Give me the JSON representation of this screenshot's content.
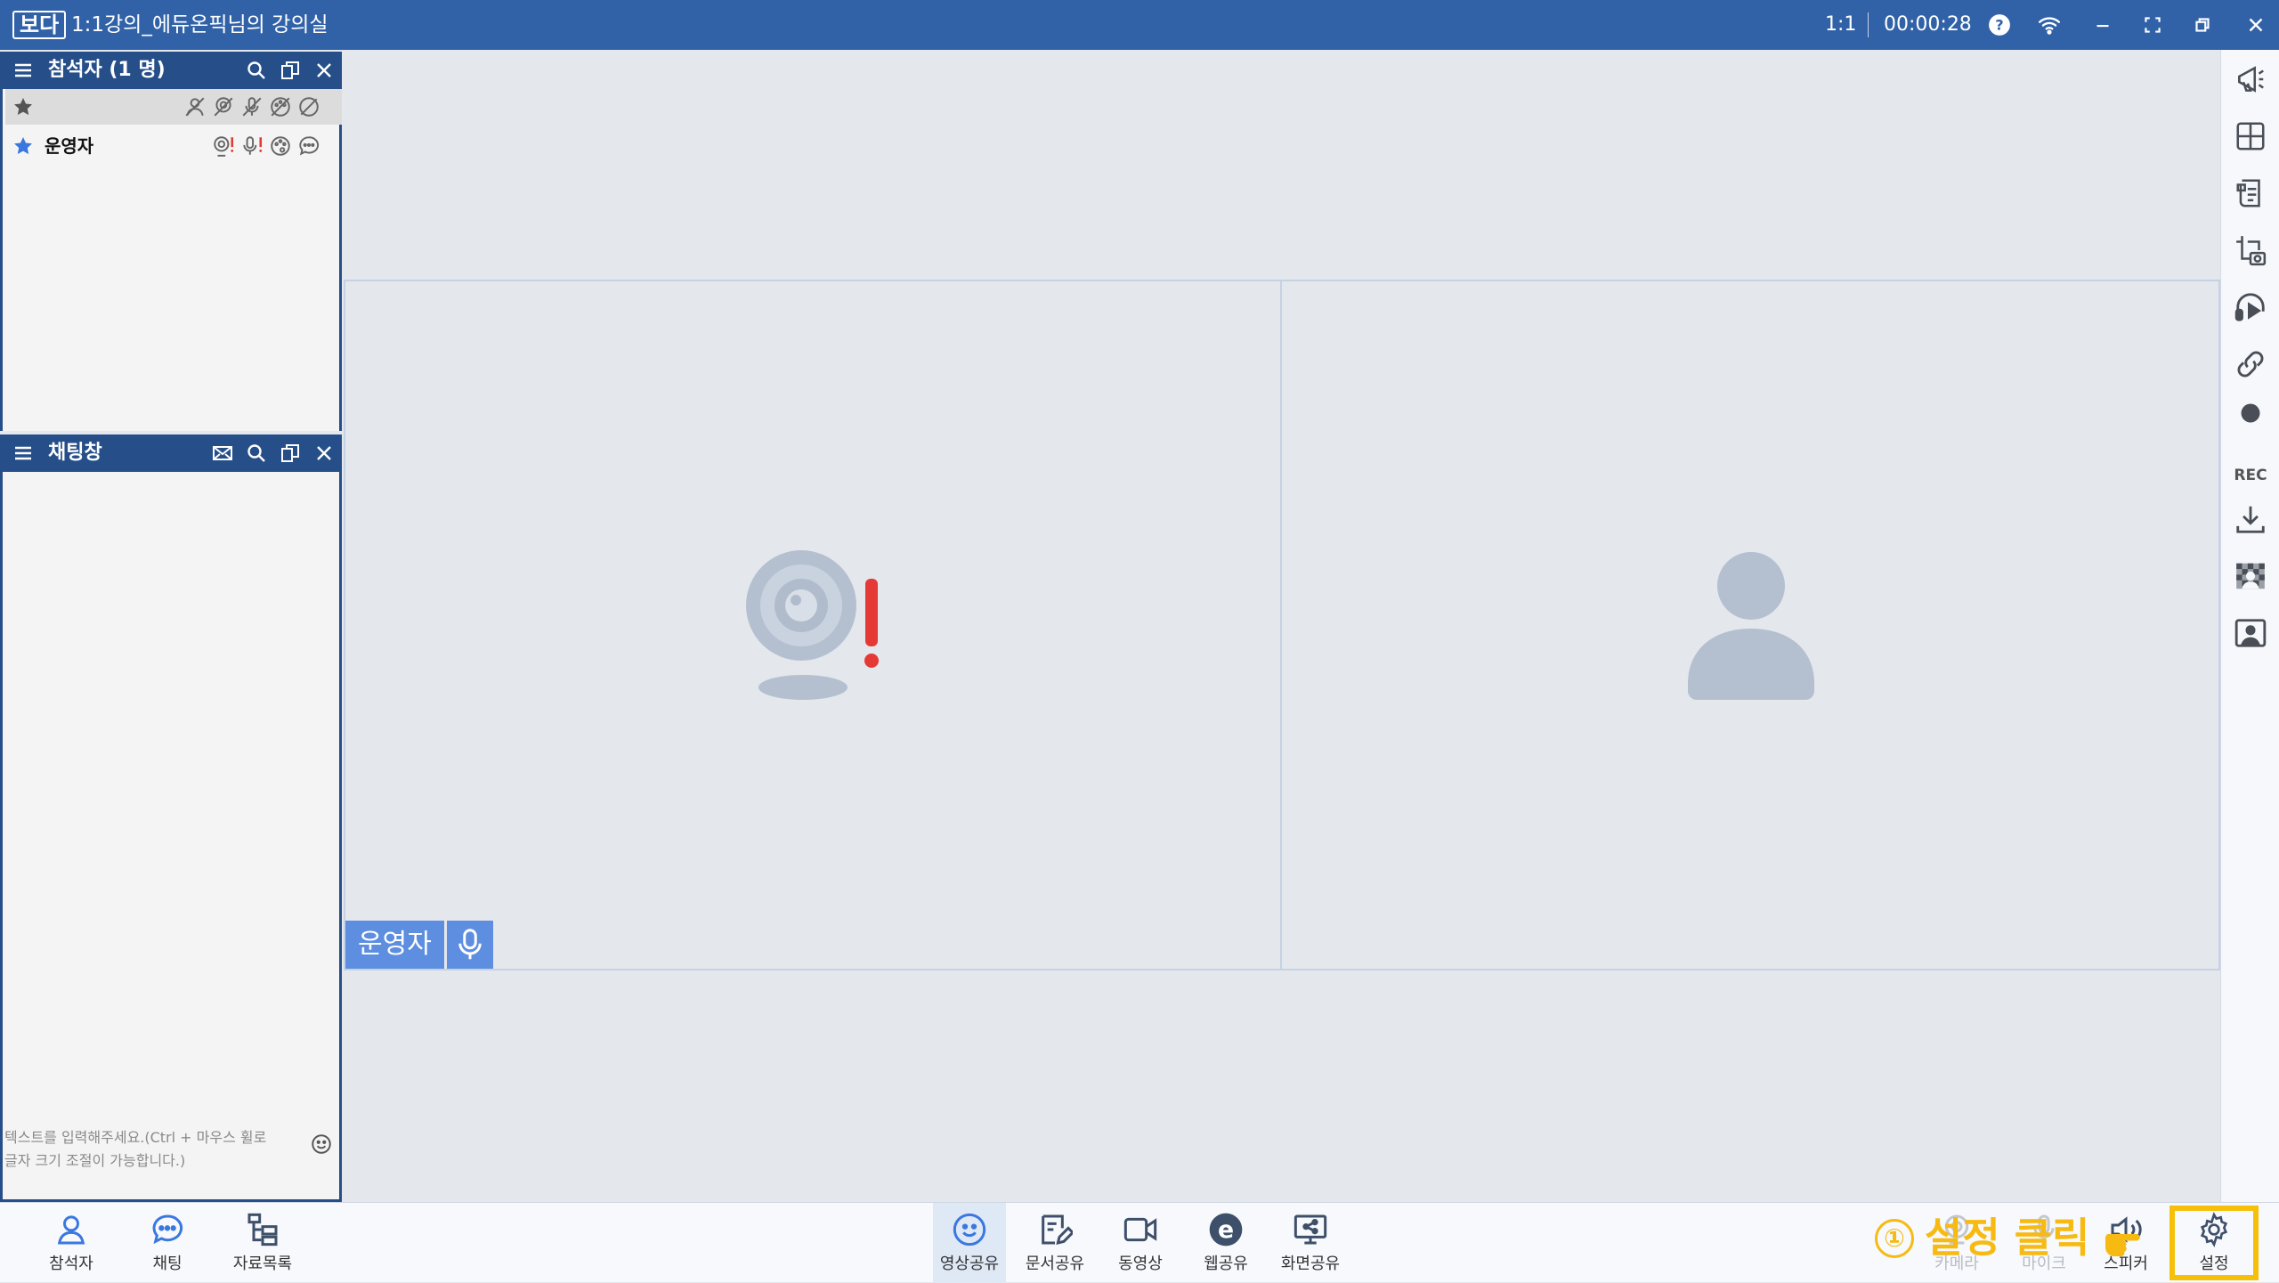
{
  "titlebar": {
    "logo": "보다",
    "title": "1:1강의_에듀온픽님의 강의실",
    "mode": "1:1",
    "timer": "00:00:28",
    "icons": [
      "help-icon",
      "wifi-icon",
      "minimize-icon",
      "fullscreen-icon",
      "restore-icon",
      "close-icon"
    ]
  },
  "participants_panel": {
    "title": "참석자 (1 명)",
    "icons": [
      "menu-icon",
      "search-icon",
      "popout-icon",
      "close-icon"
    ],
    "header_row_icons": [
      "star-icon",
      "person-off-icon",
      "camera-off-icon",
      "mic-off-icon",
      "palette-off-icon",
      "chat-off-icon"
    ],
    "users": [
      {
        "name": "운영자",
        "icons": [
          "star-icon",
          "camera-alert-icon",
          "mic-alert-icon",
          "palette-icon",
          "chat-icon"
        ]
      }
    ]
  },
  "chat_panel": {
    "title": "채팅창",
    "icons": [
      "menu-icon",
      "mail-icon",
      "search-icon",
      "popout-icon",
      "close-icon"
    ],
    "input_placeholder_line1": "텍스트를 입력해주세요.(Ctrl + 마우스 휠로",
    "input_placeholder_line2": "글자 크기 조절이 가능합니다.)",
    "emoji_icon": "smiley-icon"
  },
  "stage": {
    "tiles": [
      {
        "label": "운영자",
        "icon": "webcam-alert-icon",
        "mic_icon": "mic-icon"
      },
      {
        "label": "",
        "icon": "person-placeholder-icon"
      }
    ]
  },
  "right_toolbar": {
    "items": [
      "announce-icon",
      "layout-grid-icon",
      "document-icon",
      "screenshot-icon",
      "headset-icon",
      "link-icon",
      "record-icon",
      "download-icon",
      "mosaic-icon",
      "profile-card-icon"
    ],
    "rec_label": "REC"
  },
  "bottom_toolbar": {
    "left": [
      {
        "label": "참석자",
        "icon": "person-icon"
      },
      {
        "label": "채팅",
        "icon": "chat-bubble-icon"
      },
      {
        "label": "자료목록",
        "icon": "folder-tree-icon"
      }
    ],
    "center": [
      {
        "label": "영상공유",
        "icon": "smile-share-icon",
        "active": true
      },
      {
        "label": "문서공유",
        "icon": "doc-edit-icon"
      },
      {
        "label": "동영상",
        "icon": "video-camera-icon"
      },
      {
        "label": "웹공유",
        "icon": "web-e-icon"
      },
      {
        "label": "화면공유",
        "icon": "screen-share-icon"
      }
    ],
    "right": [
      {
        "label": "카메라",
        "icon": "camera-icon"
      },
      {
        "label": "마이크",
        "icon": "mic-icon"
      },
      {
        "label": "스피커",
        "icon": "speaker-icon"
      },
      {
        "label": "설정",
        "icon": "gear-icon"
      }
    ]
  },
  "annotation": {
    "number": "①",
    "text": "설정 클릭",
    "color": "#f6ba12"
  }
}
